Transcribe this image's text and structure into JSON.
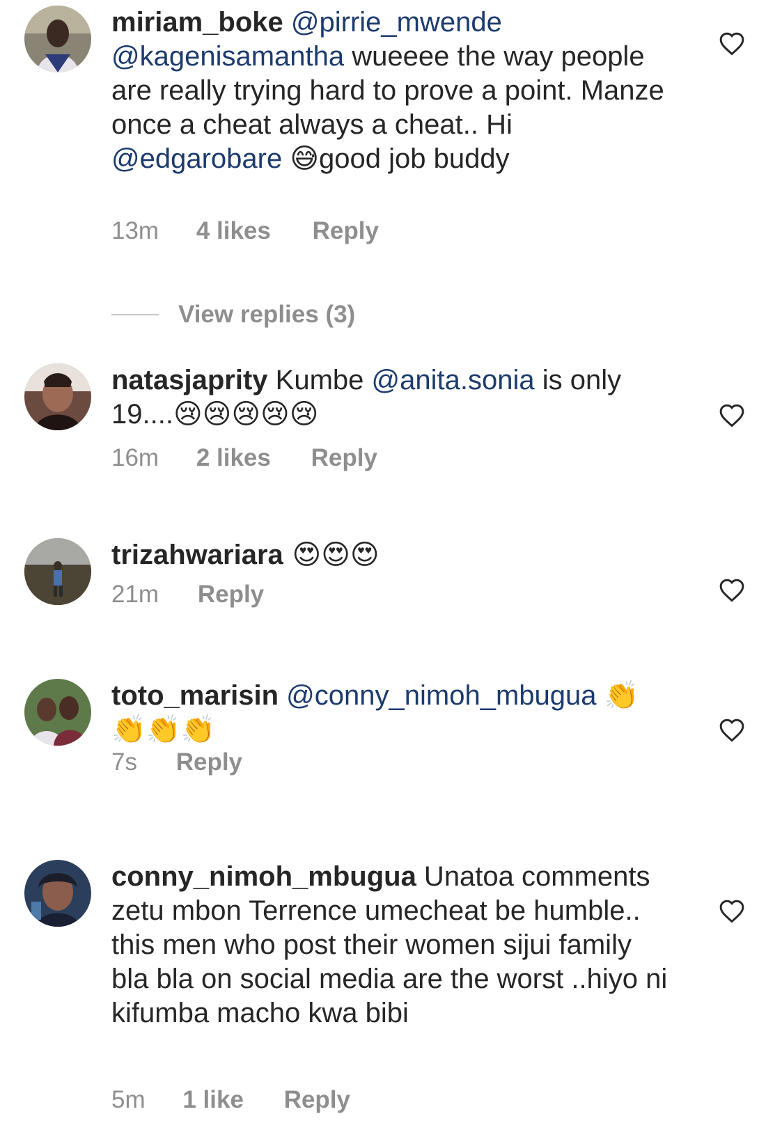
{
  "comments": [
    {
      "username": "miriam_boke",
      "text_parts": [
        "@pirrie_mwende",
        "@kagenisamantha",
        " wueeee the way people are really trying hard to prove a point. Manze once a cheat always a cheat.. Hi ",
        "@edgarobare",
        " ",
        "😅",
        "good job buddy"
      ],
      "time": "13m",
      "likes": "4 likes",
      "reply": "Reply",
      "view_replies": "View replies (3)"
    },
    {
      "username": "natasjaprity",
      "text_parts": [
        " Kumbe ",
        "@anita.sonia",
        "  is only 19....",
        "😢😢😢😢😢"
      ],
      "time": "16m",
      "likes": "2 likes",
      "reply": "Reply"
    },
    {
      "username": "trizahwariara",
      "emojis": " 😍😍😍",
      "time": "21m",
      "reply": "Reply"
    },
    {
      "username": "toto_marisin",
      "mention": "@conny_nimoh_mbugua",
      "emojis": "👏👏👏👏",
      "time": "7s",
      "reply": "Reply"
    },
    {
      "username": "conny_nimoh_mbugua",
      "text": " Unatoa comments zetu mbon Terrence umecheat be humble.. this men who post their women  sijui family bla bla on social media are the worst ..hiyo ni kifumba macho kwa bibi",
      "time": "5m",
      "likes": "1 like",
      "reply": "Reply"
    }
  ],
  "icons": {
    "like": "heart-outline-icon"
  },
  "colors": {
    "text": "#262626",
    "mention": "#1d3b6e",
    "meta": "#8e8e8e"
  }
}
